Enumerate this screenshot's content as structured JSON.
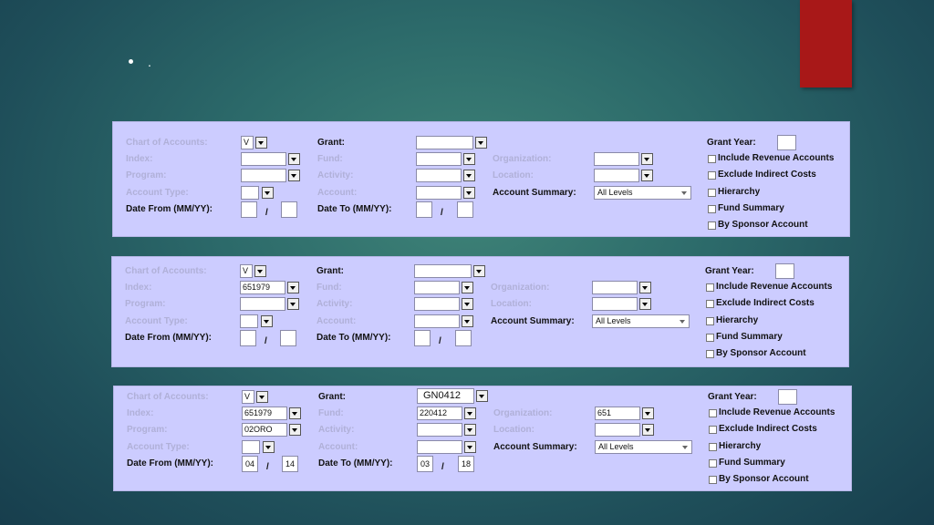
{
  "bullet_text": ".",
  "labels": {
    "chart": "Chart of Accounts:",
    "index": "Index:",
    "program": "Program:",
    "account_type": "Account Type:",
    "date_from": "Date From (MM/YY):",
    "grant": "Grant:",
    "fund": "Fund:",
    "activity": "Activity:",
    "account": "Account:",
    "date_to": "Date To (MM/YY):",
    "organization": "Organization:",
    "location": "Location:",
    "account_summary": "Account Summary:",
    "grant_year": "Grant Year:",
    "slash": "/"
  },
  "checkboxes": [
    "Include Revenue Accounts",
    "Exclude Indirect Costs",
    "Hierarchy",
    "Fund Summary",
    "By Sponsor Account"
  ],
  "account_summary_option": "All Levels",
  "forms": [
    {
      "chart": "V",
      "index": "",
      "program": "",
      "account_type": "",
      "from_mm": "",
      "from_yy": "",
      "grant": "",
      "fund": "",
      "activity": "",
      "account": "",
      "to_mm": "",
      "to_yy": "",
      "organization": "",
      "location": "",
      "grant_year": ""
    },
    {
      "chart": "V",
      "index": "651979",
      "program": "",
      "account_type": "",
      "from_mm": "",
      "from_yy": "",
      "grant": "",
      "fund": "",
      "activity": "",
      "account": "",
      "to_mm": "",
      "to_yy": "",
      "organization": "",
      "location": "",
      "grant_year": ""
    },
    {
      "chart": "V",
      "index": "651979",
      "program": "02ORO",
      "account_type": "",
      "from_mm": "04",
      "from_yy": "14",
      "grant": "GN0412",
      "fund": "220412",
      "activity": "",
      "account": "",
      "to_mm": "03",
      "to_yy": "18",
      "organization": "651",
      "location": "",
      "grant_year": ""
    }
  ]
}
